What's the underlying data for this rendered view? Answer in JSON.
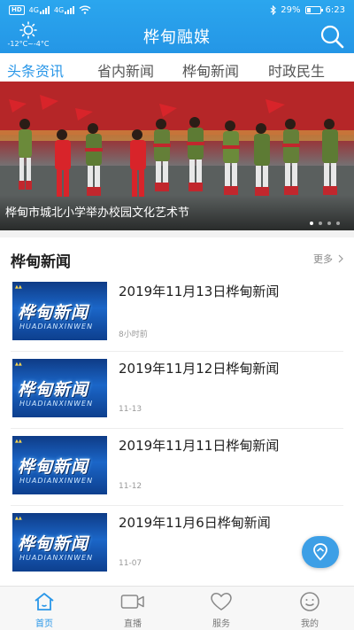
{
  "status_bar": {
    "network_tag": "HD",
    "signal_1": "4G",
    "signal_2": "4G",
    "battery": "29%",
    "time": "6:23"
  },
  "header": {
    "title": "桦甸融媒",
    "weather_temp": "-12°C~-4°C",
    "weather_icon": "sun-icon",
    "search_icon": "search-icon"
  },
  "tabs": [
    {
      "label": "头条资讯",
      "active": true
    },
    {
      "label": "省内新闻",
      "active": false
    },
    {
      "label": "桦甸新闻",
      "active": false
    },
    {
      "label": "时政民生",
      "active": false
    }
  ],
  "banner": {
    "caption": "桦甸市城北小学举办校园文化艺术节",
    "slide_count": 4,
    "current_slide": 1
  },
  "section": {
    "title": "桦甸新闻",
    "more_label": "更多"
  },
  "news": [
    {
      "title": "2019年11月13日桦甸新闻",
      "time": "8小时前",
      "thumb_text": "桦甸新闻",
      "thumb_pinyin": "HUADIANXINWEN"
    },
    {
      "title": "2019年11月12日桦甸新闻",
      "time": "11-13",
      "thumb_text": "桦甸新闻",
      "thumb_pinyin": "HUADIANXINWEN"
    },
    {
      "title": "2019年11月11日桦甸新闻",
      "time": "11-12",
      "thumb_text": "桦甸新闻",
      "thumb_pinyin": "HUADIANXINWEN"
    },
    {
      "title": "2019年11月6日桦甸新闻",
      "time": "11-07",
      "thumb_text": "桦甸新闻",
      "thumb_pinyin": "HUADIANXINWEN"
    }
  ],
  "bottom_nav": [
    {
      "label": "首页",
      "icon": "home-icon",
      "active": true
    },
    {
      "label": "直播",
      "icon": "video-camera-icon",
      "active": false
    },
    {
      "label": "服务",
      "icon": "heart-icon",
      "active": false
    },
    {
      "label": "我的",
      "icon": "smiley-icon",
      "active": false
    }
  ],
  "colors": {
    "brand_blue": "#2496e6",
    "active_tab": "#2a97e8",
    "fab": "#3d9fe6"
  }
}
